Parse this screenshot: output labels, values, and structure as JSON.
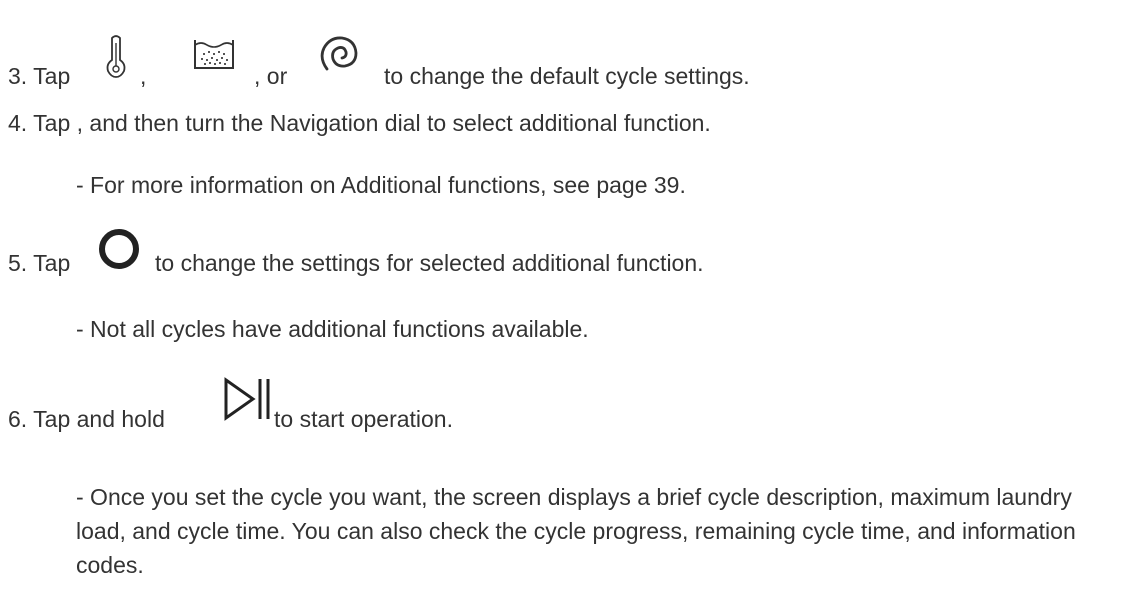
{
  "steps": [
    {
      "id": "step3",
      "prefix": "3. Tap",
      "sep1": ",",
      "sep2": ", or",
      "suffix": "to change the default cycle settings.",
      "icons": [
        "thermometer-icon",
        "soil-level-icon",
        "spin-icon"
      ]
    },
    {
      "id": "step4",
      "text": "4. Tap , and then turn the Navigation dial to select additional function.",
      "note": "- For more information on Additional functions, see page 39."
    },
    {
      "id": "step5",
      "prefix": "5. Tap",
      "suffix": "to change the settings for selected additional function.",
      "note": "- Not all cycles have additional functions available.",
      "icons": [
        "circle-icon"
      ]
    },
    {
      "id": "step6",
      "prefix": "6. Tap and hold",
      "suffix": "to start operation.",
      "note": "- Once you set the cycle you want, the screen displays a brief cycle description, maximum laundry load, and cycle time. You can also check the cycle progress, remaining cycle time, and information codes.",
      "icons": [
        "play-pause-icon"
      ]
    }
  ]
}
